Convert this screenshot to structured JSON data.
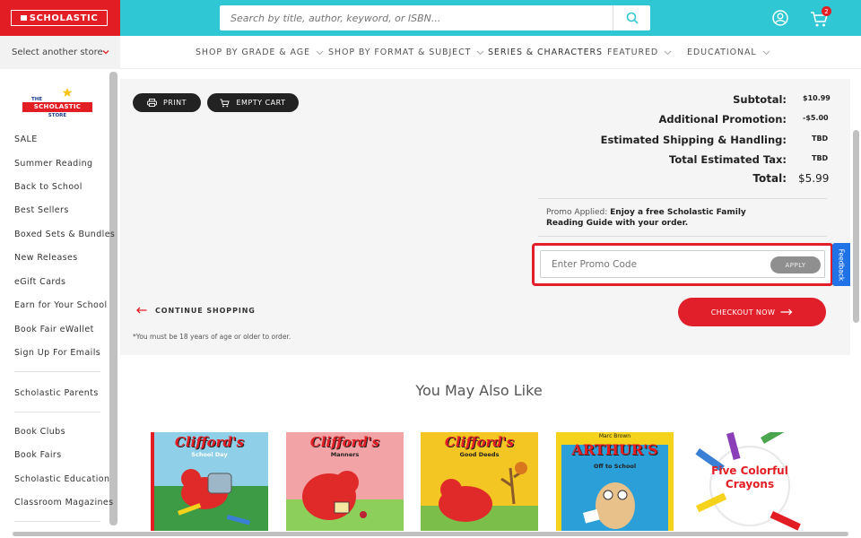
{
  "header": {
    "brand": "SCHOLASTIC",
    "search_placeholder": "Search by title, author, keyword, or ISBN...",
    "cart_count": "2"
  },
  "nav": {
    "store_select": "Select another store",
    "items": [
      "SHOP BY GRADE & AGE",
      "SHOP BY FORMAT & SUBJECT",
      "SERIES & CHARACTERS",
      "FEATURED",
      "EDUCATIONAL"
    ]
  },
  "sidebar": {
    "logo_line1": "THE",
    "logo_line2": "SCHOLASTIC",
    "logo_line3": "STORE",
    "items": [
      "SALE",
      "Summer Reading",
      "Back to School",
      "Best Sellers",
      "Boxed Sets & Bundles",
      "New Releases",
      "eGift Cards",
      "Earn for Your School",
      "Book Fair eWallet",
      "Sign Up For Emails"
    ],
    "group2": [
      "Scholastic Parents"
    ],
    "group3": [
      "Book Clubs",
      "Book Fairs",
      "Scholastic Education",
      "Classroom Magazines"
    ]
  },
  "cart": {
    "print_label": "PRINT",
    "empty_label": "EMPTY CART",
    "summary": [
      {
        "label": "Subtotal:",
        "value": "$10.99"
      },
      {
        "label": "Additional Promotion:",
        "value": "-$5.00"
      },
      {
        "label": "Estimated Shipping & Handling:",
        "value": "TBD"
      },
      {
        "label": "Total Estimated Tax:",
        "value": "TBD"
      }
    ],
    "total_label": "Total:",
    "total_value": "$5.99",
    "promo_applied_prefix": "Promo Applied:",
    "promo_applied_text": "Enjoy a free Scholastic Family Reading Guide with your order.",
    "promo_placeholder": "Enter Promo Code",
    "apply_label": "APPLY",
    "continue_label": "CONTINUE SHOPPING",
    "checkout_label": "CHECKOUT NOW",
    "age_note": "*You must be 18 years of age or older to order.",
    "feedback_label": "Feedback"
  },
  "recommendations": {
    "title": "You May Also Like",
    "books": [
      {
        "title": "Clifford's",
        "subtitle": "School Day",
        "color": "#4aa54f"
      },
      {
        "title": "Clifford's",
        "subtitle": "Manners",
        "color": "#f2a3a5"
      },
      {
        "title": "Clifford's",
        "subtitle": "Good Deeds",
        "color": "#f3c623"
      },
      {
        "title": "ARTHUR'S",
        "subtitle": "Off to School",
        "color": "#f5d21c"
      },
      {
        "title": "Five Colorful Crayons",
        "subtitle": "",
        "color": "#ffffff"
      }
    ],
    "arthur_author": "Marc Brown"
  },
  "colors": {
    "brand_red": "#e31d24",
    "header_teal": "#2ec7d3",
    "feedback_blue": "#2172e6"
  }
}
